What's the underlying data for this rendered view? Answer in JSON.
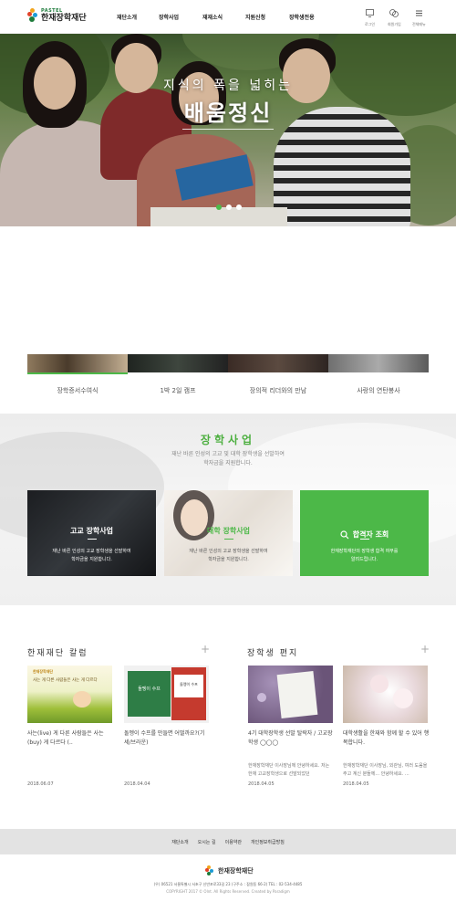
{
  "logo": {
    "sub": "PASTEL",
    "main": "한재장학재단"
  },
  "nav": [
    "재단소개",
    "장학사업",
    "재재소식",
    "지원신청",
    "장학생전용"
  ],
  "utilities": [
    {
      "icon": "monitor-icon",
      "label": "로그인"
    },
    {
      "icon": "people-icon",
      "label": "회원가입"
    },
    {
      "icon": "menu-icon",
      "label": "전체메뉴"
    }
  ],
  "hero": {
    "line1": "지식의 폭을 넓히는",
    "line2": "배움정신",
    "slides": 3,
    "active_slide": 1
  },
  "gallery": {
    "items": [
      "장학증서수여식",
      "1박 2일 캠프",
      "장의적 리더와의 만남",
      "사랑의 연탄봉사"
    ]
  },
  "scholarship": {
    "title": "장학사업",
    "desc_line1": "재난 바른 인성의 고교 및 대학 장학생을 선발하여",
    "desc_line2": "학자금을 지원합니다.",
    "cards": [
      {
        "title": "고교 장학사업",
        "desc_line1": "재난 바른 인성의 고교 장학생을 선발하여",
        "desc_line2": "학자금을 지원합니다."
      },
      {
        "title": "대학 장학사업",
        "desc_line1": "재난 바른 인성의 고교 장학생을 선발하여",
        "desc_line2": "학자금을 지원합니다."
      },
      {
        "title": "합격자 조회",
        "icon": "search-icon",
        "desc_line1": "한재장학재단의 장학생 합격 여부를",
        "desc_line2": "알려드립니다.",
        "color": "#4cb848"
      }
    ]
  },
  "column": {
    "title": "한재재단 칼럼",
    "more": "+",
    "posts": [
      {
        "thumb_text": "사는 게 다른 사람들은 사는 게 다르다",
        "title": "사는(live) 게 다른 사람들은 사는(buy) 게 다르다 (..",
        "date": "2018.06.07"
      },
      {
        "thumb_text": "돌멩이 수프",
        "thumb_text2": "돌멩이 수프",
        "title": "돌멩이 수프를 만들면 어떨까요?(기세/브라운)",
        "date": "2018.04.04"
      }
    ]
  },
  "letters": {
    "title": "장학생 편지",
    "more": "+",
    "posts": [
      {
        "title": "4기 대학장학생 선발 탈락자 / 고교장학생 ◯◯◯",
        "body": "한재장학재단 이사장님께 안녕하세요. 저는 한재 고교장학생으로 선발되었던",
        "date": "2018.04.05"
      },
      {
        "title": "대학생활을 한재와 함께 할 수 있어 행복합니다.",
        "body": "한재장학재단 이사장님, 외관님, 여러 도움을 주고 계신 분들께... 안녕하세요. ...",
        "date": "2018.04.05"
      }
    ]
  },
  "footer": {
    "links": [
      "재단소개",
      "오시는 길",
      "이용약관",
      "개인정보취급방침"
    ],
    "logo": "한재장학재단",
    "address": "(우) 06521 서울특별시 서초구 신반포로33길 23 (구주소 : 잠원동 66-2)     TEL : 02-534-4485",
    "copyright": "COPYRIGHT 2017 © Olnt. All Rights Reserved.     Created by Paradigm"
  },
  "colors": {
    "accent": "#4cb848",
    "footer_bar": "#e3e3e3"
  }
}
